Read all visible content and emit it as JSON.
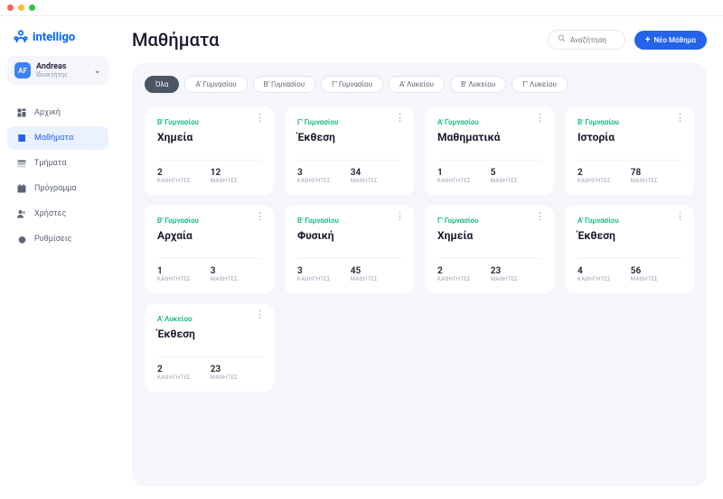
{
  "brand": "intelligo",
  "user": {
    "initials": "AF",
    "name": "Andreas",
    "role": "Ιδιοκτήτης"
  },
  "nav": [
    {
      "label": "Αρχική",
      "icon": "dashboard"
    },
    {
      "label": "Μαθήματα",
      "icon": "book",
      "active": true
    },
    {
      "label": "Τμήματα",
      "icon": "layers"
    },
    {
      "label": "Πρόγραμμα",
      "icon": "calendar"
    },
    {
      "label": "Χρήστες",
      "icon": "users"
    },
    {
      "label": "Ρυθμίσεις",
      "icon": "gear"
    }
  ],
  "page": {
    "title": "Μαθήματα"
  },
  "search": {
    "placeholder": "Αναζήτηση"
  },
  "primary_button": "Νέο Μάθημα",
  "filters": [
    {
      "label": "Όλα",
      "active": true
    },
    {
      "label": "Α' Γυμνασίου"
    },
    {
      "label": "Β' Γυμνασίου"
    },
    {
      "label": "Γ' Γυμνασίου"
    },
    {
      "label": "Α' Λυκείου"
    },
    {
      "label": "Β' Λυκείου"
    },
    {
      "label": "Γ' Λυκείου"
    }
  ],
  "stat_labels": {
    "teachers": "ΚΑΘΗΓΗΤΕΣ",
    "students": "ΜΑΘΗΤΕΣ"
  },
  "courses": [
    {
      "grade": "Β' Γυμνασίου",
      "title": "Χημεία",
      "teachers": "2",
      "students": "12"
    },
    {
      "grade": "Γ' Γυμνασίου",
      "title": "Έκθεση",
      "teachers": "3",
      "students": "34"
    },
    {
      "grade": "Α' Γυμνασίου",
      "title": "Μαθηματικά",
      "teachers": "1",
      "students": "5"
    },
    {
      "grade": "Β' Γυμνασίου",
      "title": "Ιστορία",
      "teachers": "2",
      "students": "78"
    },
    {
      "grade": "Β' Γυμνασίου",
      "title": "Αρχαία",
      "teachers": "1",
      "students": "3"
    },
    {
      "grade": "Β' Γυμνασίου",
      "title": "Φυσική",
      "teachers": "3",
      "students": "45"
    },
    {
      "grade": "Γ' Γυμνασίου",
      "title": "Χημεία",
      "teachers": "2",
      "students": "23"
    },
    {
      "grade": "Α' Γυμνασίου",
      "title": "Έκθεση",
      "teachers": "4",
      "students": "56"
    },
    {
      "grade": "Α' Λυκείου",
      "title": "Έκθεση",
      "teachers": "2",
      "students": "23"
    }
  ]
}
